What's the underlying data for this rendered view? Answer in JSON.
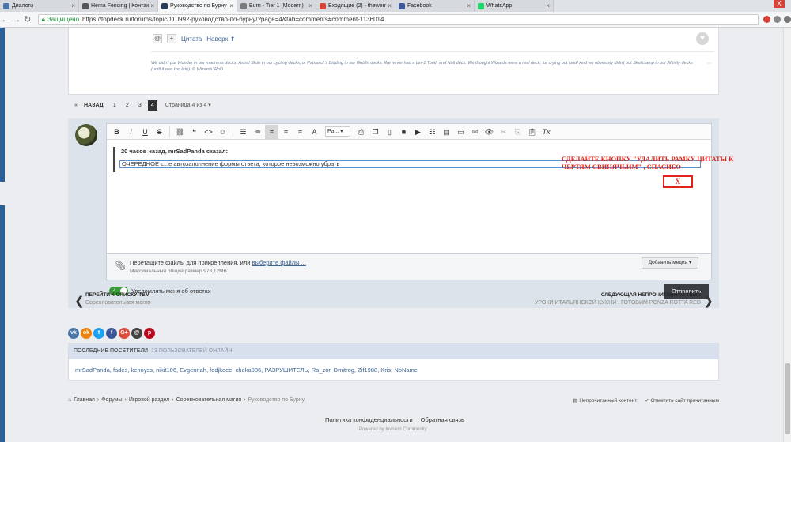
{
  "tabs": [
    {
      "label": "Диалоги",
      "color": "#4a76a8",
      "active": false
    },
    {
      "label": "Hema Fencing | Контакт",
      "color": "#555555",
      "active": false
    },
    {
      "label": "Руководство по Бурну",
      "color": "#2b3b5c",
      "active": true
    },
    {
      "label": "Burn - Tier 1 (Modern)",
      "color": "#7a7a7a",
      "active": false
    },
    {
      "label": "Входящие (2) - thewerm",
      "color": "#d44638",
      "active": false
    },
    {
      "label": "Facebook",
      "color": "#3b5998",
      "active": false
    },
    {
      "label": "WhatsApp",
      "color": "#25d366",
      "active": false
    }
  ],
  "window_close": "X",
  "address": {
    "secure_label": "Защищено",
    "url": "https://topdeck.ru/forums/topic/110992-руководство-по-бурну/?page=4&tab=comments#comment-1136014"
  },
  "comment": {
    "quote_label": "Цитата",
    "top_label": "Наверх",
    "signature": "We didn't put Wonder in our madness decks, Astral Slide in our cycling decks, or Patriarch's Bidding in our Goblin decks. We never had a tier-1 Tooth and Nail deck. We thought Wizards were a real deck, for crying out loud! And we obviously didn't put Skullclamp in our Affinity decks (until it was too late). © Wizards' RnD"
  },
  "pager": {
    "back": "НАЗАД",
    "pages": [
      "1",
      "2",
      "3",
      "4"
    ],
    "current": "4",
    "summary": "Страница 4 из 4"
  },
  "editor": {
    "font_select": "Ра...",
    "quote_header": "20 часов назад, mrSadPanda сказал:",
    "quote_text_pre": "ОЧЕРЕДНОЕ с...",
    "quote_text_err": "е автозаполнение",
    "quote_text_post": " формы ответа, которое невозможно убрать"
  },
  "annotation": {
    "text": "СДЕЛАЙТЕ КНОПКУ \"УДАЛИТЬ РАМКУ ЦИТАТЫ К ЧЕРТЯМ СВИНЯЧЬИМ\" , СПАСИБО",
    "box": "X",
    "color": "#e2231a"
  },
  "attach": {
    "text": "Перетащите файлы для прикрепления, или ",
    "link": "выберите файлы ...",
    "size_label": "Максимальный общий размер",
    "size_value": "973,12MB",
    "media_button": "Добавить медиа"
  },
  "notify_label": "Уведомлять меня об ответах",
  "send_button": "Отправить",
  "prev_topic": {
    "title": "ПЕРЕЙТИ К СПИСКУ ТЕМ",
    "sub": "Соревновательная магия"
  },
  "next_topic": {
    "title": "СЛЕДУЮЩАЯ НЕПРОЧИТАННАЯ ТЕМА",
    "sub": "УРОКИ ИТАЛЬЯНСКОЙ КУХНИ : ГОТОВИМ PONZA ROTTA RED"
  },
  "shares": [
    {
      "label": "vk",
      "color": "#4a76a8"
    },
    {
      "label": "ok",
      "color": "#ee8208"
    },
    {
      "label": "t",
      "color": "#1da1f2"
    },
    {
      "label": "f",
      "color": "#3b5998"
    },
    {
      "label": "G+",
      "color": "#dd4b39"
    },
    {
      "label": "@",
      "color": "#444444"
    },
    {
      "label": "p",
      "color": "#bd081c"
    }
  ],
  "visitors": {
    "title": "ПОСЛЕДНИЕ ПОСЕТИТЕЛИ",
    "count": "13 ПОЛЬЗОВАТЕЛЕЙ ОНЛАЙН",
    "list": "mrSadPanda, fades, kennyss, nikit106, Evgennah, fedjkeee, cheka086, РАЗРУШИТЕЛЬ, Ra_zor, Dmitrog, Zif1988, Kris, NoName"
  },
  "breadcrumbs": [
    "Главная",
    "Форумы",
    "Игровой раздел",
    "Соревновательная магия",
    "Руководство по Бурну"
  ],
  "footer": {
    "unread": "Непрочитанный контент",
    "mark_read": "Отметить сайт прочитанным",
    "privacy": "Политика конфиденциальности",
    "feedback": "Обратная связь",
    "powered": "Powered by Invision Community"
  }
}
